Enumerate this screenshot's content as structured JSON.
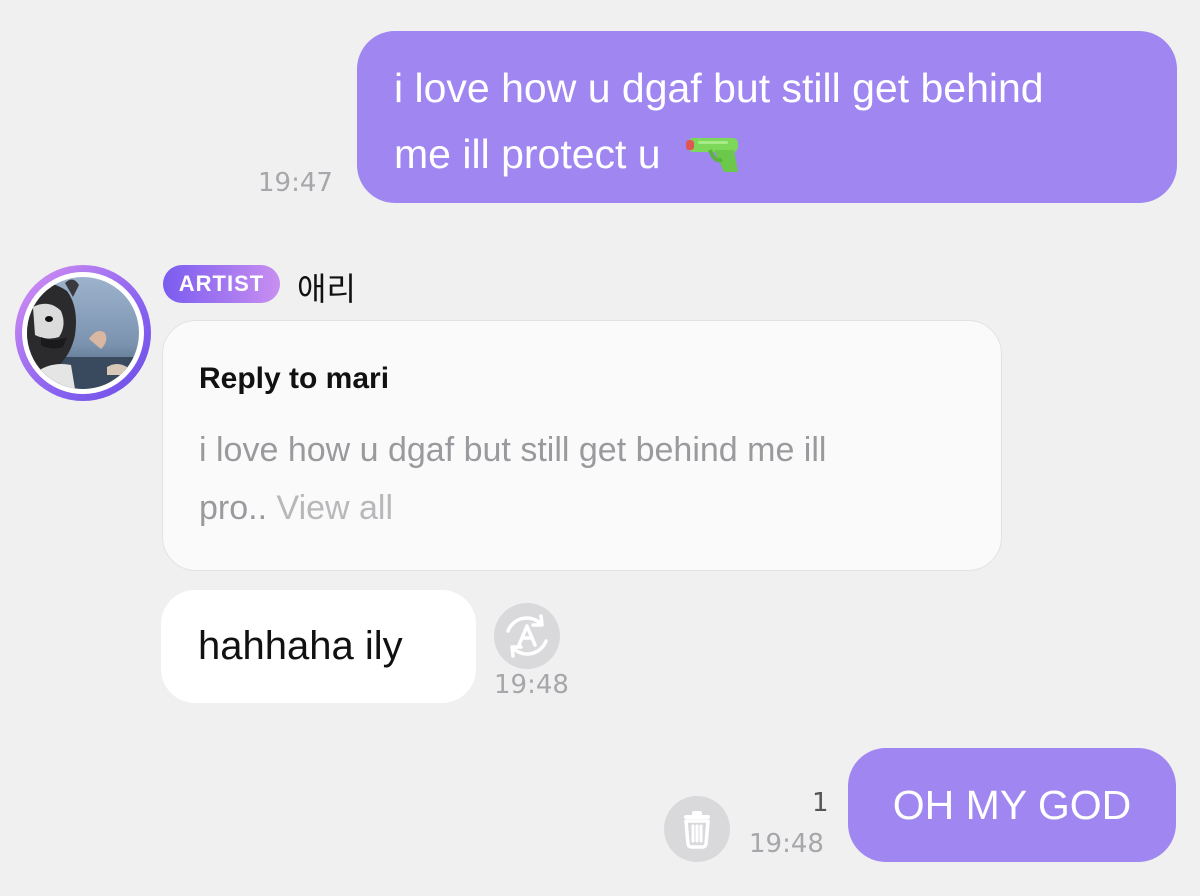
{
  "messages": {
    "outgoing_1": {
      "line1": "i love how u dgaf but still get behind",
      "line2": "me ill protect u",
      "emoji": "water-pistol-icon",
      "time": "19:47"
    },
    "incoming_1": {
      "badge": "ARTIST",
      "sender": "애리",
      "reply": {
        "title": "Reply to mari",
        "quote_line1": "i love how u dgaf but still get behind me ill",
        "quote_line2": "pro..",
        "view_all": "View all"
      },
      "text": "hahhaha ily",
      "time": "19:48",
      "translate_icon": "translate-icon"
    },
    "outgoing_2": {
      "text": "OH MY GOD",
      "unread_count": "1",
      "time": "19:48",
      "delete_icon": "trash-icon"
    }
  },
  "colors": {
    "background": "#f0f0f1",
    "outgoing_bubble": "#9f86f0",
    "artist_badge_start": "#7b5cf0",
    "artist_badge_end": "#c88ff0",
    "timestamp": "#a7a7ab"
  }
}
